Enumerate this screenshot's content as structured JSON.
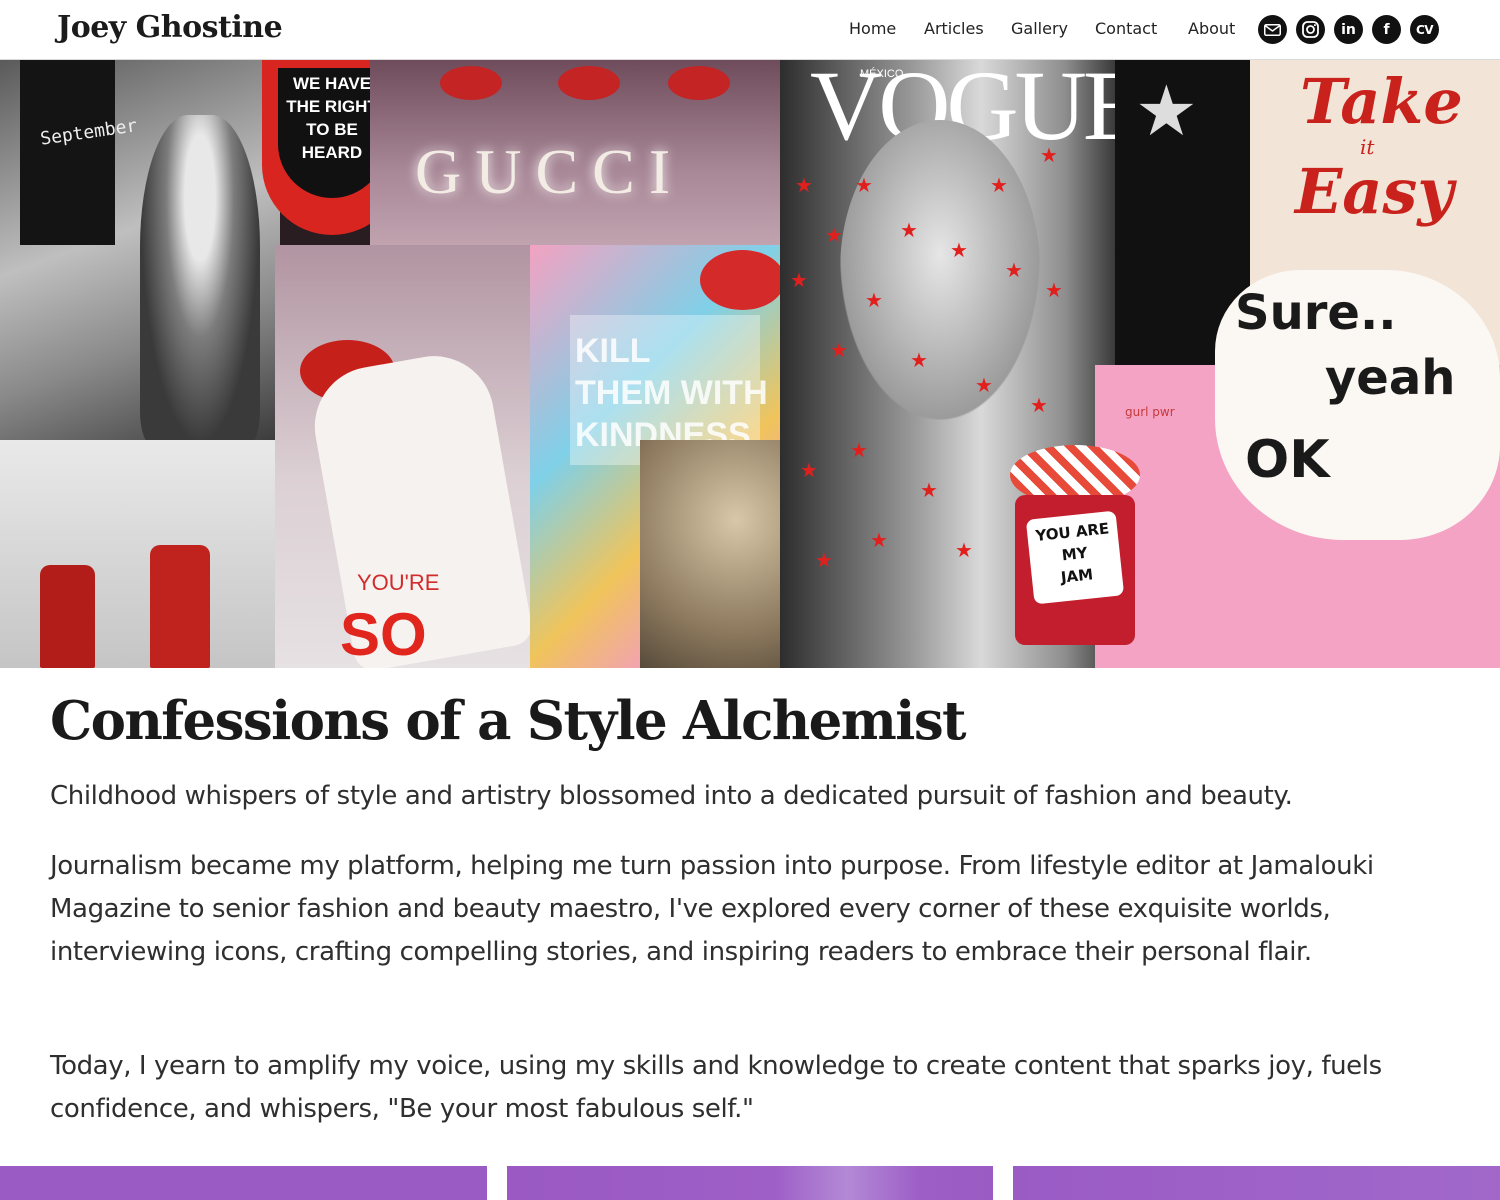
{
  "site": {
    "brand": "Joey Ghostine"
  },
  "nav": {
    "items": [
      {
        "label": "Home"
      },
      {
        "label": "Articles"
      },
      {
        "label": "Gallery"
      },
      {
        "label": "Contact"
      },
      {
        "label": "About"
      }
    ],
    "social": [
      {
        "name": "email",
        "icon": "mail-icon"
      },
      {
        "name": "instagram",
        "icon": "instagram-icon"
      },
      {
        "name": "linkedin",
        "icon": "linkedin-icon",
        "text": "in"
      },
      {
        "name": "facebook",
        "icon": "facebook-icon",
        "text": "f"
      },
      {
        "name": "cv",
        "icon": "cv-icon",
        "text": "CV"
      }
    ]
  },
  "hero": {
    "collage_text": {
      "mouth_sign": [
        "WE HAVE",
        "THE RIGHT",
        "TO BE",
        "HEARD"
      ],
      "gucci": "GUCCI",
      "vogue": "VOGUE",
      "vogue_mexico": "MÉXICO",
      "kill": [
        "KILL",
        "THEM WITH",
        "KINDNESS"
      ],
      "take_it_easy": [
        "Take",
        "it",
        "Easy"
      ],
      "sure_yeah_ok": [
        "Sure..",
        "yeah",
        "OK"
      ],
      "jam": [
        "YOU ARE",
        "MY",
        "JAM"
      ],
      "youre_so": [
        "YOU'RE",
        "SO"
      ],
      "september": "September",
      "gurl": "gurl pwr"
    }
  },
  "article": {
    "headline": "Confessions of a Style Alchemist",
    "paragraphs": [
      "Childhood whispers of style and artistry blossomed into a dedicated pursuit of fashion and beauty.",
      "Journalism became my platform, helping me turn passion into purpose. From lifestyle editor at Jamalouki Magazine to senior fashion and beauty maestro, I've explored every corner of these exquisite worlds, interviewing icons, crafting compelling stories, and inspiring readers to embrace their personal flair.",
      "Today, I yearn to amplify my voice, using my skills and knowledge to create content that sparks joy, fuels confidence, and whispers, \"Be your most fabulous self.\""
    ]
  },
  "colors": {
    "accent_purple": "#9b5bc4",
    "lip_red": "#d42a2a",
    "text_dark": "#1a1a1a"
  }
}
